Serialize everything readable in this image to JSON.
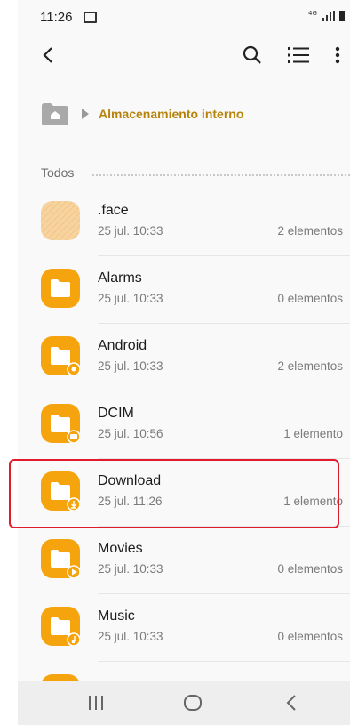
{
  "status_bar": {
    "time": "11:26",
    "network": "4G",
    "icons": [
      "image-icon",
      "signal-icon",
      "battery-icon"
    ]
  },
  "toolbar": {
    "icons": [
      "back-arrow-icon",
      "search-icon",
      "list-view-icon",
      "more-options-icon"
    ]
  },
  "breadcrumb": {
    "home_icon": "home-folder-icon",
    "separator_icon": "chevron-right-icon",
    "current": "Almacenamiento interno"
  },
  "section": {
    "title": "Todos"
  },
  "files": [
    {
      "name": ".face",
      "date": "25 jul. 10:33",
      "count": "2 elementos",
      "icon": "hidden-folder-icon"
    },
    {
      "name": "Alarms",
      "date": "25 jul. 10:33",
      "count": "0 elementos",
      "icon": "folder-icon"
    },
    {
      "name": "Android",
      "date": "25 jul. 10:33",
      "count": "2 elementos",
      "icon": "folder-settings-icon"
    },
    {
      "name": "DCIM",
      "date": "25 jul. 10:56",
      "count": "1 elemento",
      "icon": "folder-camera-icon"
    },
    {
      "name": "Download",
      "date": "25 jul. 11:26",
      "count": "1 elemento",
      "icon": "folder-download-icon"
    },
    {
      "name": "Movies",
      "date": "25 jul. 10:33",
      "count": "0 elementos",
      "icon": "folder-play-icon"
    },
    {
      "name": "Music",
      "date": "25 jul. 10:33",
      "count": "0 elementos",
      "icon": "folder-music-icon"
    }
  ],
  "highlighted_item": "Download",
  "nav_bar": {
    "icons": [
      "recent-apps-icon",
      "home-icon",
      "back-icon"
    ]
  },
  "colors": {
    "folder": "#f5a40e",
    "breadcrumb_text": "#b7830b",
    "highlight_border": "#e11b2a"
  }
}
